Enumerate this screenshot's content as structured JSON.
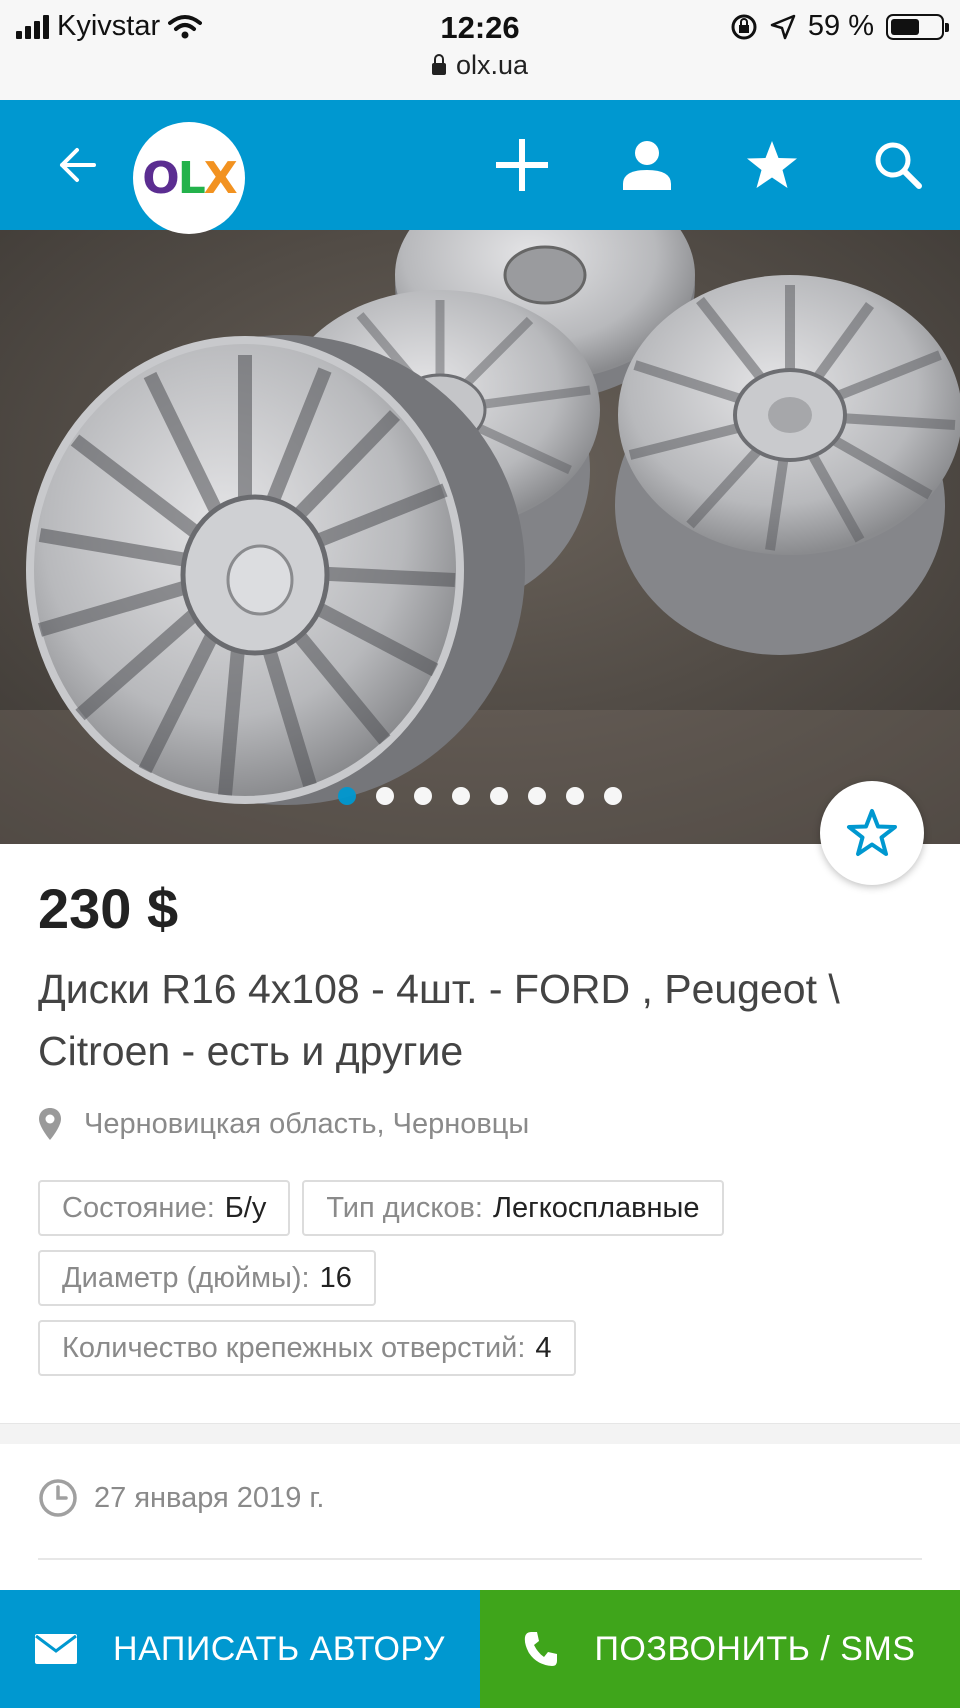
{
  "status_bar": {
    "carrier": "Kyivstar",
    "time": "12:26",
    "battery_percent": "59 %",
    "battery_level": 0.59,
    "url": "olx.ua"
  },
  "header": {
    "logo": "OLX",
    "icons": [
      "back-arrow-icon",
      "plus-icon",
      "user-icon",
      "star-icon",
      "search-icon"
    ]
  },
  "gallery": {
    "photo_count": 8,
    "active_index": 0
  },
  "listing": {
    "price": "230 $",
    "title": "Диски R16 4x108 - 4шт. - FORD , Peugeot \\ Citroen - есть и другие",
    "location": "Черновицкая область, Черновцы",
    "params": [
      {
        "label": "Состояние:",
        "value": "Б/у"
      },
      {
        "label": "Тип дисков:",
        "value": "Легкосплавные"
      },
      {
        "label": "Диаметр (дюймы):",
        "value": "16"
      },
      {
        "label": "Количество крепежных отверстий:",
        "value": "4"
      }
    ],
    "date": "27 января 2019 г."
  },
  "actions": {
    "write_label": "НАПИСАТЬ АВТОРУ",
    "call_label": "ПОЗВОНИТЬ / SMS"
  },
  "colors": {
    "brand_blue": "#0098d0",
    "call_green": "#3fa51b"
  }
}
